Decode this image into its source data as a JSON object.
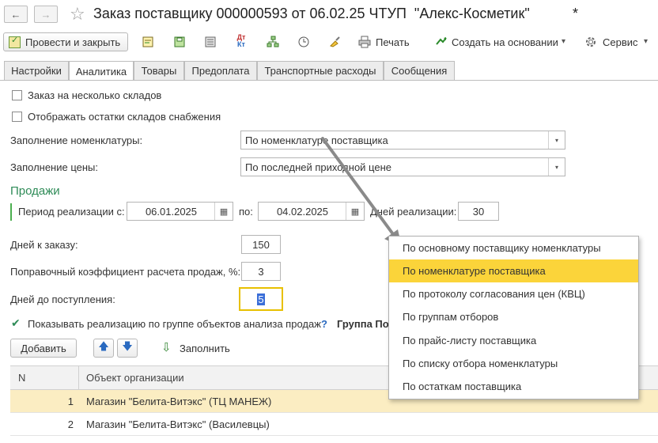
{
  "window": {
    "title": "Заказ поставщику 000000593 от 06.02.25 ЧТУП  \"Алекс-Косметик\"",
    "modified_mark": "*",
    "back_glyph": "←",
    "forward_glyph": "→",
    "star_glyph": "☆"
  },
  "toolbar": {
    "post_close_label": "Провести и закрыть",
    "print_label": "Печать",
    "create_based_label": "Создать на основании",
    "service_label": "Сервис",
    "dropdown_glyph": "▾",
    "icons": [
      "document-edit-icon",
      "save-icon",
      "journal-icon",
      "dt-kt-icon",
      "structure-icon",
      "history-icon",
      "brush-icon",
      "printer-icon",
      "create-based-icon",
      "gear-icon"
    ]
  },
  "tabs": [
    {
      "label": "Настройки",
      "active": false
    },
    {
      "label": "Аналитика",
      "active": true
    },
    {
      "label": "Товары",
      "active": false
    },
    {
      "label": "Предоплата",
      "active": false
    },
    {
      "label": "Транспортные расходы",
      "active": false
    },
    {
      "label": "Сообщения",
      "active": false
    }
  ],
  "form": {
    "multi_warehouse_label": "Заказ на несколько складов",
    "multi_warehouse_checked": false,
    "show_stock_label": "Отображать остатки складов снабжения",
    "show_stock_checked": false,
    "fill_nomenclature_label": "Заполнение номенклатуры:",
    "fill_nomenclature_value": "По номенклатуре поставщика",
    "fill_price_label": "Заполнение цены:",
    "fill_price_value": "По последней приходной цене",
    "sales_section_title": "Продажи",
    "period_label": "Период реализации с:",
    "period_from": "06.01.2025",
    "period_to_label": "по:",
    "period_to": "04.02.2025",
    "days_sales_label": "Дней реализации:",
    "days_sales_value": "30",
    "days_order_label": "Дней к заказу:",
    "days_order_value": "150",
    "coef_label": "Поправочный коэффициент расчета продаж, %:",
    "coef_value": "3",
    "days_arrival_label": "Дней до поступления:",
    "days_arrival_value": "5",
    "show_by_group_label": "Показывать реализацию по группе объектов анализа продаж",
    "show_by_group_checked": true,
    "help_glyph": "?",
    "group_label": "Группа По",
    "calendar_glyph": "▦",
    "check_glyph": "✔"
  },
  "table_toolbar": {
    "add_label": "Добавить",
    "up_glyph": "🡅",
    "down_glyph": "🡇",
    "fill_glyph": "⇩",
    "fill_label": "Заполнить"
  },
  "table": {
    "columns": [
      "N",
      "Объект организации"
    ],
    "rows": [
      {
        "n": "1",
        "object": "Магазин \"Белита-Витэкс\" (ТЦ МАНЕЖ)",
        "selected": true
      },
      {
        "n": "2",
        "object": "Магазин \"Белита-Витэкс\" (Василевцы)",
        "selected": false
      }
    ]
  },
  "dropdown": {
    "options": [
      "По основному поставщику номенклатуры",
      "По номенклатуре поставщика",
      "По протоколу согласования цен (КВЦ)",
      "По группам отборов",
      "По прайс-листу поставщика",
      "По списку отбора номенклатуры",
      "По остаткам поставщика"
    ],
    "selected_index": 1
  },
  "colors": {
    "accent_green": "#2e8b57",
    "selection_yellow": "#fbd43a",
    "row_highlight": "#fbedc2",
    "focus_border": "#e8c000"
  }
}
